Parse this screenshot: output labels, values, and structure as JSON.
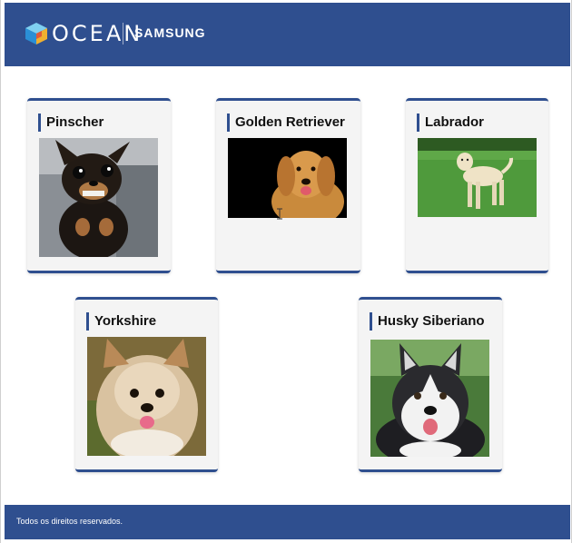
{
  "header": {
    "logo_text": "OCEAN",
    "partner_text": "SAMSUNG",
    "background": "#2f4f8f"
  },
  "cards": [
    {
      "title": "Pinscher",
      "image_icon": "pinscher-photo"
    },
    {
      "title": "Golden Retriever",
      "image_icon": "golden-retriever-photo"
    },
    {
      "title": "Labrador",
      "image_icon": "labrador-photo"
    },
    {
      "title": "Yorkshire",
      "image_icon": "yorkshire-photo"
    },
    {
      "title": "Husky Siberiano",
      "image_icon": "husky-siberiano-photo"
    }
  ],
  "footer": {
    "text": "Todos os direitos reservados."
  },
  "colors": {
    "accent": "#2f4f8f",
    "card_bg": "#f4f4f4"
  }
}
